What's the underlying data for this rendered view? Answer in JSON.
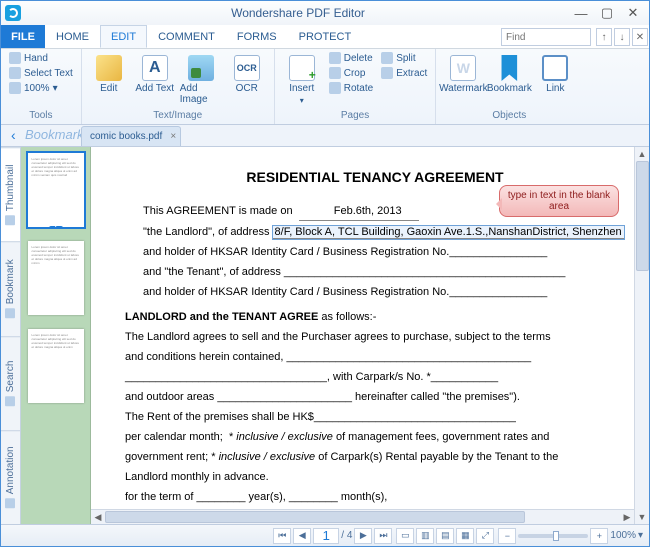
{
  "app": {
    "title": "Wondershare PDF Editor"
  },
  "window_controls": {
    "min": "—",
    "max": "▢",
    "close": "✕"
  },
  "menu": {
    "file": "FILE",
    "tabs": [
      "HOME",
      "EDIT",
      "COMMENT",
      "FORMS",
      "PROTECT"
    ],
    "active": 1,
    "find_placeholder": "Find",
    "mini": [
      "↑",
      "↓",
      "✕"
    ]
  },
  "ribbon": {
    "groups": [
      {
        "label": "Tools",
        "items": [
          {
            "name": "hand",
            "label": "Hand"
          },
          {
            "name": "select-text",
            "label": "Select Text"
          },
          {
            "name": "zoom",
            "label": "100%",
            "dropdown": true
          }
        ]
      },
      {
        "label": "Text/Image",
        "big": [
          {
            "name": "edit",
            "label": "Edit"
          },
          {
            "name": "add-text",
            "label": "Add Text"
          },
          {
            "name": "add-image",
            "label": "Add Image"
          },
          {
            "name": "ocr",
            "label": "OCR"
          }
        ]
      },
      {
        "label": "Pages",
        "big": [
          {
            "name": "insert",
            "label": "Insert",
            "dropdown": true
          }
        ],
        "items": [
          {
            "name": "delete",
            "label": "Delete"
          },
          {
            "name": "crop",
            "label": "Crop"
          },
          {
            "name": "rotate",
            "label": "Rotate"
          },
          {
            "name": "split",
            "label": "Split"
          },
          {
            "name": "extract",
            "label": "Extract"
          }
        ]
      },
      {
        "label": "Objects",
        "big": [
          {
            "name": "watermark",
            "label": "Watermark",
            "dropdown": true
          },
          {
            "name": "bookmark",
            "label": "Bookmark"
          },
          {
            "name": "link",
            "label": "Link"
          }
        ]
      }
    ]
  },
  "doctabs": {
    "panel_label": "Bookmark",
    "tabs": [
      {
        "label": "comic books.pdf"
      }
    ]
  },
  "side_tabs": [
    "Thumbnail",
    "Bookmark",
    "Search",
    "Annotation"
  ],
  "thumbnails": [
    {
      "page": "1",
      "active": true
    },
    {
      "page": "2"
    },
    {
      "page": "3"
    }
  ],
  "callout": "type in text in the blank area",
  "document": {
    "title": "RESIDENTIAL TENANCY AGREEMENT",
    "line1_a": "This AGREEMENT is made on",
    "line1_date": "Feb.6th, 2013",
    "line2_a": "\"the Landlord\", of address",
    "line2_addr": "8/F, Block A, TCL Building, Gaoxin Ave.1.S.,NanshanDistrict, Shenzhen",
    "line3": "and holder of HKSAR Identity Card / Business Registration No.________________",
    "line4": "and \"the Tenant\", of address ______________________________________________",
    "line5": "and holder of HKSAR Identity Card / Business Registration No.________________",
    "section": "LANDLORD and the TENANT AGREE",
    "section_tail": " as follows:-",
    "b1": "The Landlord agrees to sell and the Purchaser agrees to purchase, subject to the terms",
    "b2": "and conditions herein contained, ________________________________________",
    "b3": "_________________________________, with Carpark/s No. *___________",
    "b4": "and outdoor areas ______________________ hereinafter called \"the premises\").",
    "b5": "The Rent of the premises shall be HK$_________________________________",
    "b6": "per calendar month;  * inclusive / exclusive of management fees, government rates and",
    "b7": "government rent; * inclusive / exclusive of Carpark(s) Rental payable by the Tenant to the",
    "b8": "Landlord monthly in advance.",
    "b9": "for the term of ________ year(s), ________ month(s),"
  },
  "status": {
    "nav": {
      "first": "⏮",
      "prev": "◀",
      "page": "1",
      "total": "/ 4",
      "next": "▶",
      "last": "⏭"
    },
    "views": [
      "▭",
      "▥",
      "▤",
      "▦",
      "⤢"
    ],
    "zoom": {
      "out": "−",
      "in": "+",
      "value": "100%",
      "dropdown": "▾"
    }
  }
}
